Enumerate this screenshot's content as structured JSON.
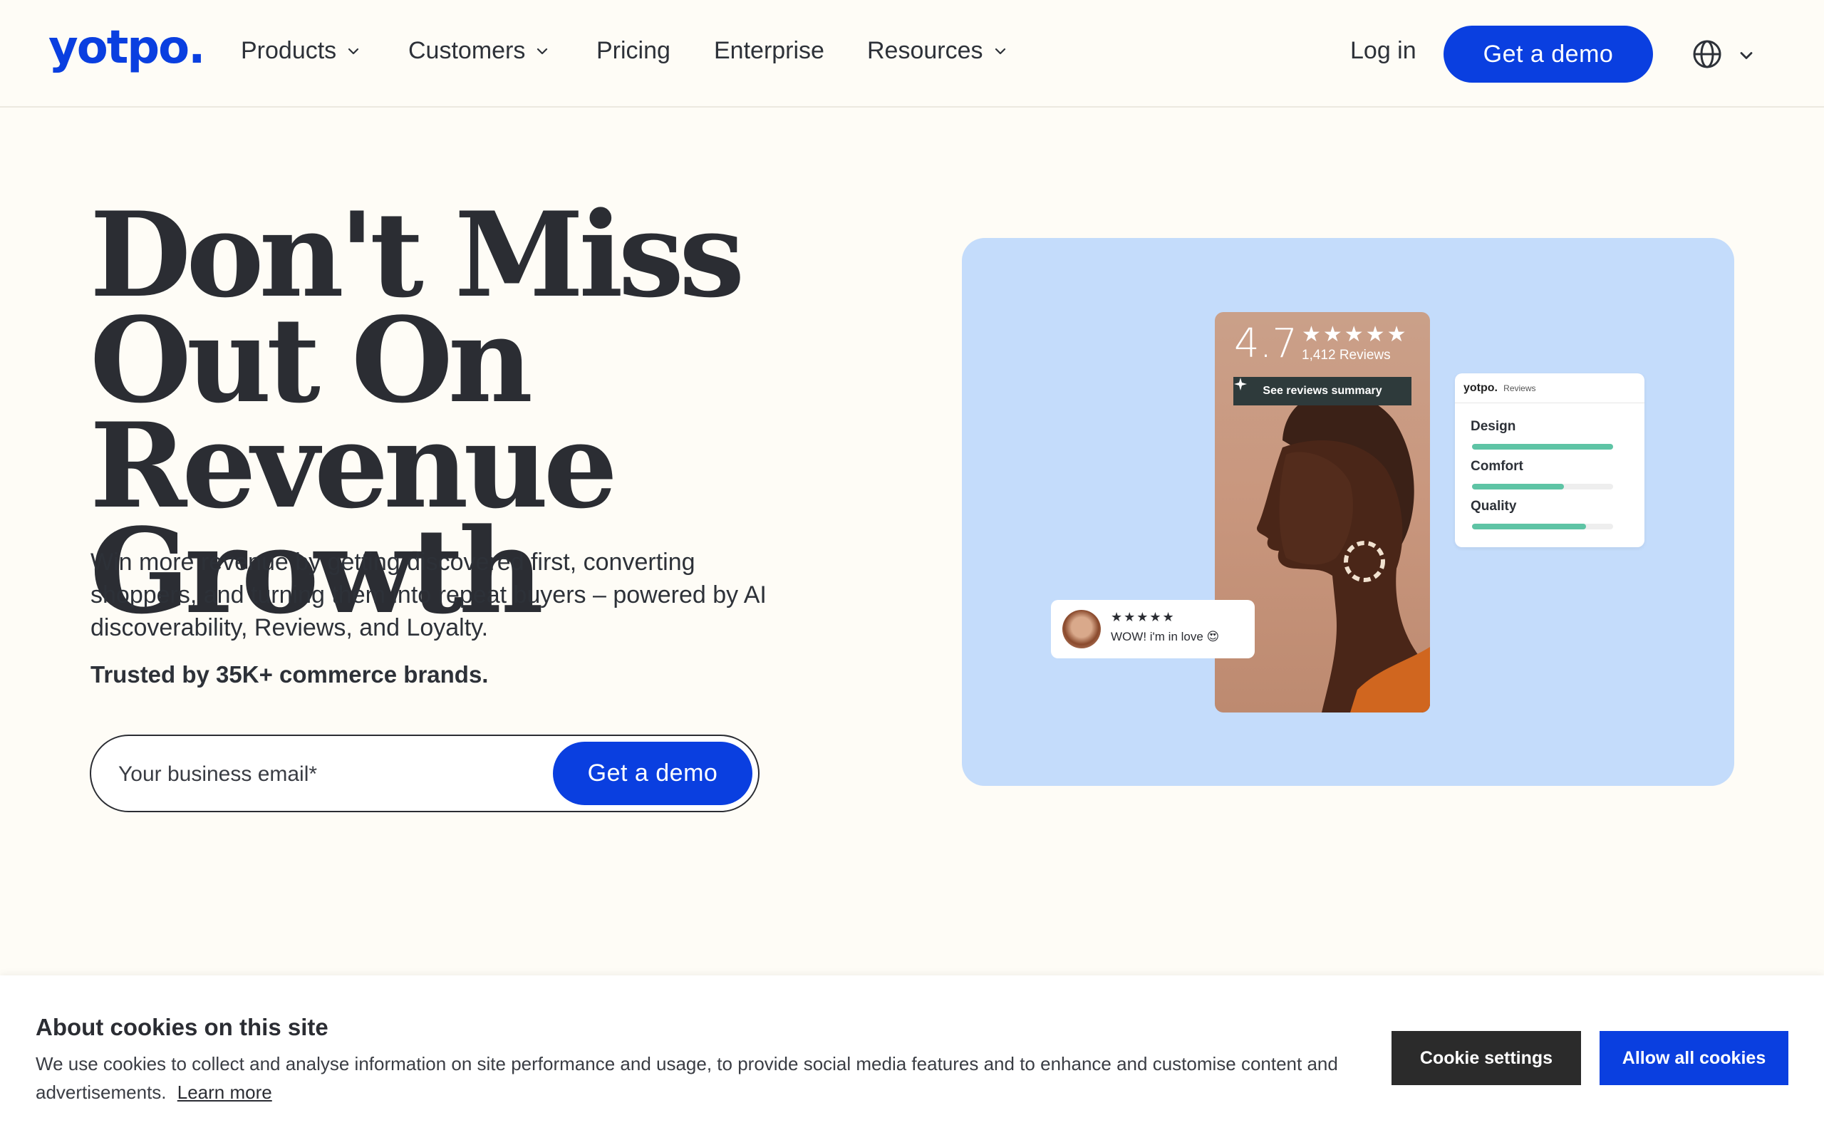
{
  "nav": {
    "logo": "yotpo.",
    "items": [
      {
        "label": "Products",
        "has_dropdown": true
      },
      {
        "label": "Customers",
        "has_dropdown": true
      },
      {
        "label": "Pricing",
        "has_dropdown": false
      },
      {
        "label": "Enterprise",
        "has_dropdown": false
      },
      {
        "label": "Resources",
        "has_dropdown": true
      }
    ],
    "login": "Log in",
    "demo_button": "Get a demo",
    "language_icon": "globe-icon"
  },
  "hero": {
    "headline": "Don't Miss Out On Revenue Growth",
    "subcopy": "Win more revenue by getting discovered first, converting shoppers, and turning them into repeat buyers – powered by AI discoverability, Reviews, and Loyalty.",
    "trusted": "Trusted by 35K+ commerce brands.",
    "email_placeholder": "Your business email*",
    "form_button": "Get a demo"
  },
  "visual": {
    "rating": "4.7",
    "stars": "★★★★★",
    "review_count": "1,412 Reviews",
    "summary_button": "See reviews summary",
    "reviews_card": {
      "logo": "yotpo.",
      "subtitle": "Reviews",
      "attributes": [
        {
          "label": "Design",
          "score": 1.0
        },
        {
          "label": "Comfort",
          "score": 0.65
        },
        {
          "label": "Quality",
          "score": 0.81
        }
      ],
      "bar_color": "#5ec4a5"
    },
    "comment": {
      "stars": "★★★★★",
      "text": "WOW! i'm in love 😍"
    }
  },
  "cookie": {
    "title": "About cookies on this site",
    "text": "We use cookies to collect and analyse information on site performance and usage, to provide social media features and to enhance and customise content and advertisements.",
    "learn_more": "Learn more",
    "settings_button": "Cookie settings",
    "allow_button": "Allow all cookies"
  },
  "colors": {
    "brand": "#0a3fe0",
    "background": "#fefcf6",
    "visual_bg": "#c4dcfb",
    "text": "#2b2d33"
  }
}
